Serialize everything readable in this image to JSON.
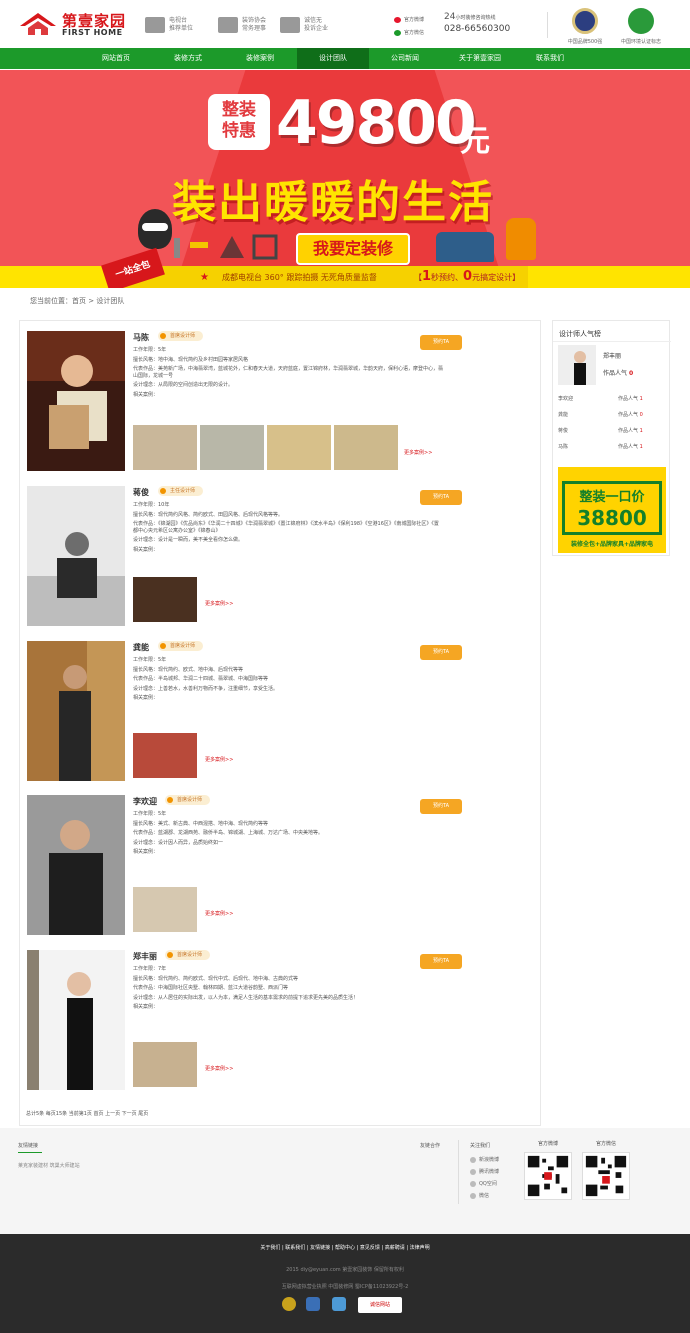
{
  "header": {
    "logo_cn": "第壹家园",
    "logo_en": "FIRST HOME",
    "badges": [
      {
        "line1": "电视台",
        "line2": "推荐单位",
        "icon": "tv-icon"
      },
      {
        "line1": "装饰协会",
        "line2": "常务理事",
        "icon": "building-icon"
      },
      {
        "line1": "诚信无",
        "line2": "投诉企业",
        "icon": "people-icon"
      }
    ],
    "weibo_1": "官方微博",
    "weibo_2": "官方微信",
    "hotline_num": "24",
    "hotline_label": "小时装修咨询热线",
    "phone": "028-66560300",
    "cert_1": "中国品牌500强",
    "cert_2": "中国环境认证标志"
  },
  "nav": [
    "网站首页",
    "装修方式",
    "装修案例",
    "设计团队",
    "公司新闻",
    "关于第壹家园",
    "联系我们"
  ],
  "nav_active": 3,
  "banner": {
    "tag_line1": "整装",
    "tag_line2": "特惠",
    "price": "49800",
    "unit": "元",
    "slogan": "装出暖暖的生活",
    "button": "我要定装修",
    "corner": "一站全包",
    "strip_text": "成都电视台 360° 跟踪拍摄  无死角质量监督",
    "strip_right_1": "1",
    "strip_right_2": "秒预约",
    "strip_right_3": "0",
    "strip_right_4": "元搞定设计"
  },
  "breadcrumb": "您当前位置：首页 > 设计团队",
  "designers": [
    {
      "name": "马陈",
      "badge": "首席设计师",
      "years": "工作年限：5年",
      "style": "擅长风格：地中海、现代简约及乡村田园等家居风格",
      "works": "代表作品：美苑新广场，中海翡翠湾，蓝城花外，仁和春天大道，天府蓝庭，置江锦府林，华润翡翠城，华韵天府，保利心语，摩登中心，翡山国际，龙城一号",
      "idea": "设计理念：从局限的空间创造出无限的设计。",
      "cases_label": "相关案例：",
      "more": "更多案例>>",
      "button": "预约TA"
    },
    {
      "name": "蒋俊",
      "badge": "主任设计师",
      "years": "工作年限：10年",
      "style": "擅长风格：现代简约风格、简约欧式、田园风格、后现代风格等等。",
      "works": "代表作品：《锦湖园》《优品尚东》《华润二十四城》《华润翡翠城》《置江锦府林》《滨水半岛》《保利198》《空港16区》《南城国际社区》《置都中心央元希区公寓办公室》《锦春山》",
      "idea": "设计理念：设计是一瞬而，美不美全看你怎么做。",
      "cases_label": "相关案例：",
      "more": "更多案例>>",
      "button": "预约TA"
    },
    {
      "name": "龚能",
      "badge": "首席设计师",
      "years": "工作年限：5年",
      "style": "擅长风格：现代简约、欧式、地中海、后现代等等",
      "works": "代表作品：半岛城邦、华润二十四城、翡翠城、中海国际等等",
      "idea": "设计理念：上善若水，水善利万物而不争，注重细节，享受生活。",
      "cases_label": "相关案例：",
      "more": "更多案例>>",
      "button": "预约TA"
    },
    {
      "name": "李欢迎",
      "badge": "首席设计师",
      "years": "工作年限：5年",
      "style": "擅长风格：美式、新古典、中西混搭、地中海、现代简约等等",
      "works": "代表作品：蓝湖郡、龙湖西苑、融侨半岛、锦城湖、上海城、万达广场、中央美地等。",
      "idea": "设计理念：设计因人而异，品质始终如一",
      "cases_label": "相关案例：",
      "more": "更多案例>>",
      "button": "预约TA"
    },
    {
      "name": "郑丰丽",
      "badge": "首席设计师",
      "years": "工作年限：7年",
      "style": "擅长风格：现代简约、简约欧式、现代中式、后现代、地中海、古典的式等",
      "works": "代表作品：中海国际社区央墅、翰林四期、蓝江大道谷韵墅、西派门等",
      "idea": "设计理念：从人居住的实际出发，以人为本，满足人生活的基本需求的前提下追求更先美的品质生活！",
      "cases_label": "相关案例：",
      "more": "更多案例>>",
      "button": "预约TA"
    }
  ],
  "pager": "总计5条  每页15条  当前第1页  首页  上一页  下一页  尾页",
  "sidebar": {
    "title": "设计师人气榜",
    "top_name": "郑丰丽",
    "top_pop_label": "作品人气",
    "top_pop_value": "0",
    "ranks": [
      {
        "name": "李欢迎",
        "label": "作品人气",
        "value": "1"
      },
      {
        "name": "龚能",
        "label": "作品人气",
        "value": "0"
      },
      {
        "name": "蒋俊",
        "label": "作品人气",
        "value": "1"
      },
      {
        "name": "马陈",
        "label": "作品人气",
        "value": "1"
      }
    ],
    "ad_line1": "整装一口价",
    "ad_line2": "38800",
    "ad_line3": "装修全包+品牌家具+品牌家电"
  },
  "footer": {
    "links_title": "友情链接",
    "links": "莱克家装建材  筑巢大师建站",
    "partner": "友链合作",
    "follow_title": "关注我们",
    "follow_items": [
      "新浪微博",
      "腾讯微博",
      "QQ空间",
      "微信"
    ],
    "qr1_label": "官方微博",
    "qr2_label": "官方微信",
    "bottom_links": "关于我们  |  联系我们  |  友情链接  |  帮助中心  |  意见反馈  |  高薪聘请  |  法律声明",
    "copy1": "2015 diy@eyuan.com 第壹家园装饰 保留所有权利",
    "copy2": "互联网虚拟营业执照 中国装修网 蜀ICP备11023922号-2",
    "badge": "诚信网站"
  },
  "colors": {
    "brand_green": "#1c9a2a",
    "brand_red": "#d7171b",
    "accent_orange": "#f5a623"
  }
}
